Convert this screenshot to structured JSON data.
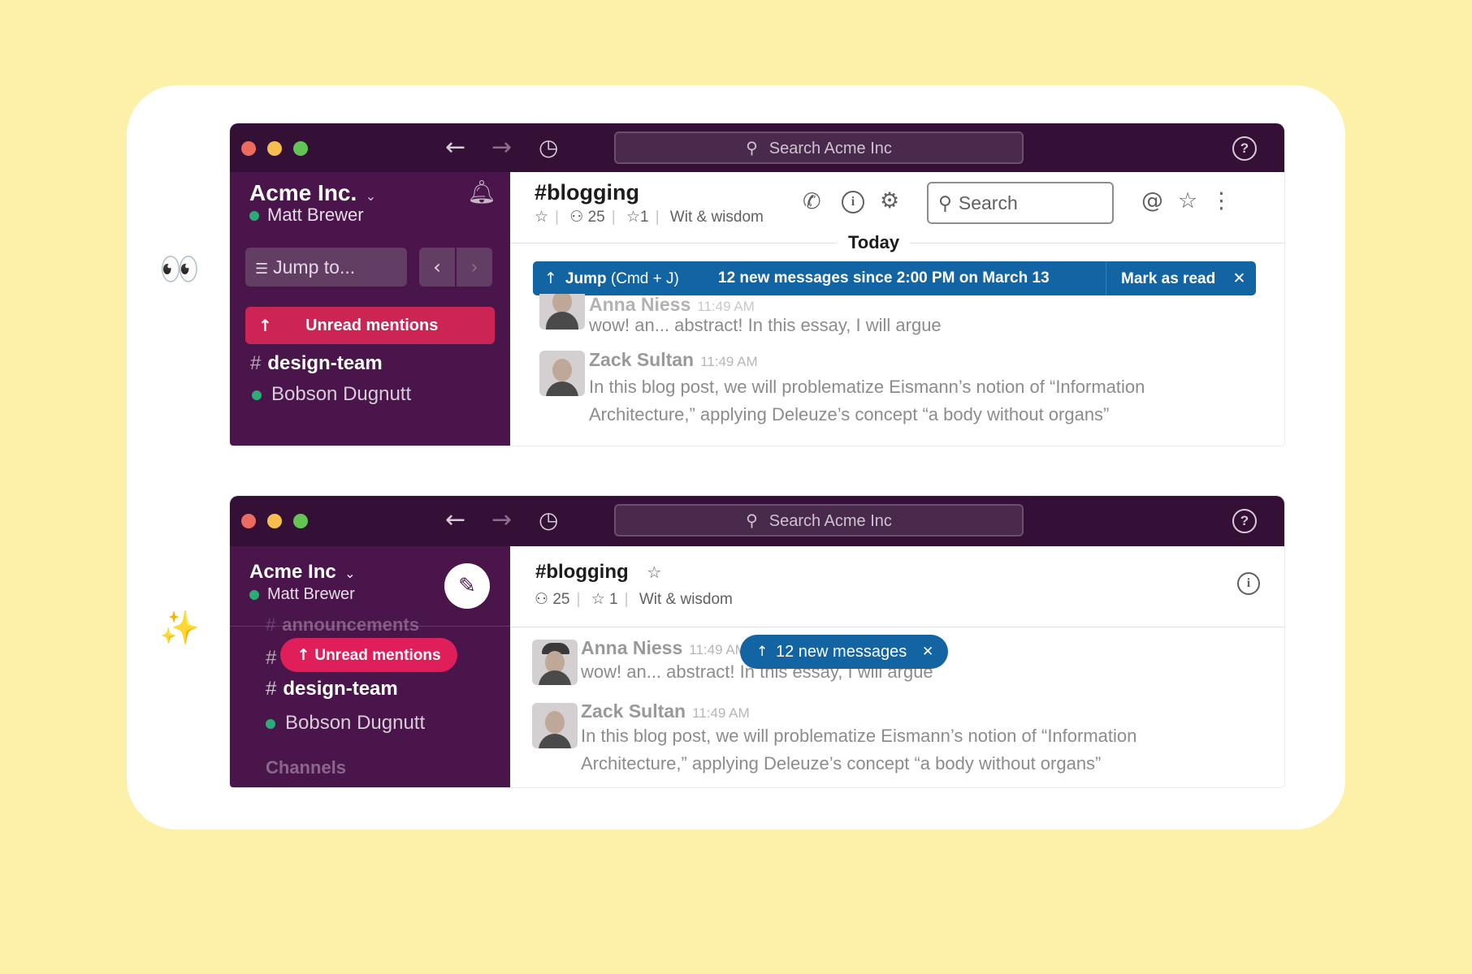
{
  "window1": {
    "titlebar": {
      "search_placeholder": "Search Acme Inc"
    },
    "sidebar": {
      "workspace": "Acme Inc.",
      "user": "Matt Brewer",
      "jump_to": "Jump to...",
      "unread_label": "Unread mentions",
      "channel": "design-team",
      "dm": "Bobson Dugnutt"
    },
    "header": {
      "channel_title": "#blogging",
      "member_count": "25",
      "pinned_count": "1",
      "topic": "Wit & wisdom",
      "search_label": "Search"
    },
    "today_label": "Today",
    "banner": {
      "jump_label": "Jump",
      "jump_shortcut": "(Cmd + J)",
      "message": "12 new messages since 2:00 PM on March 13",
      "mark_read": "Mark as read"
    },
    "messages": [
      {
        "author": "Anna Niess",
        "time": "11:49 AM",
        "text": "wow! an... abstract! In this essay, I will argue"
      },
      {
        "author": "Zack Sultan",
        "time": "11:49 AM",
        "text": "In this blog post, we will problematize Eismann’s notion of “Information Architecture,” applying Deleuze’s concept “a body without organs”"
      }
    ]
  },
  "window2": {
    "titlebar": {
      "search_placeholder": "Search Acme Inc"
    },
    "sidebar": {
      "workspace": "Acme Inc",
      "user": "Matt Brewer",
      "faded_channel": "announcements",
      "unread_label": "Unread mentions",
      "channel": "design-team",
      "dm": "Bobson Dugnutt",
      "faded_section": "Channels"
    },
    "header": {
      "channel_title": "#blogging",
      "member_count": "25",
      "pinned_count": "1",
      "topic": "Wit & wisdom"
    },
    "new_messages_pill": "12 new messages",
    "messages": [
      {
        "author": "Anna Niess",
        "time": "11:49 AM",
        "text": "wow! an... abstract! In this essay, I will argue"
      },
      {
        "author": "Zack Sultan",
        "time": "11:49 AM",
        "text": "In this blog post, we will problematize Eismann’s notion of “Information Architecture,” applying Deleuze’s concept “a body without organs”"
      }
    ]
  },
  "decorations": {
    "before_emoji": "eyes-emoji",
    "after_emoji": "sparkles-emoji"
  },
  "colors": {
    "background": "#fdf1a9",
    "sidebar": "#4a154b",
    "titlebar": "#341036",
    "unread_red": "#cd2553",
    "pill_red": "#e01e5a",
    "banner_blue": "#1264a3"
  }
}
